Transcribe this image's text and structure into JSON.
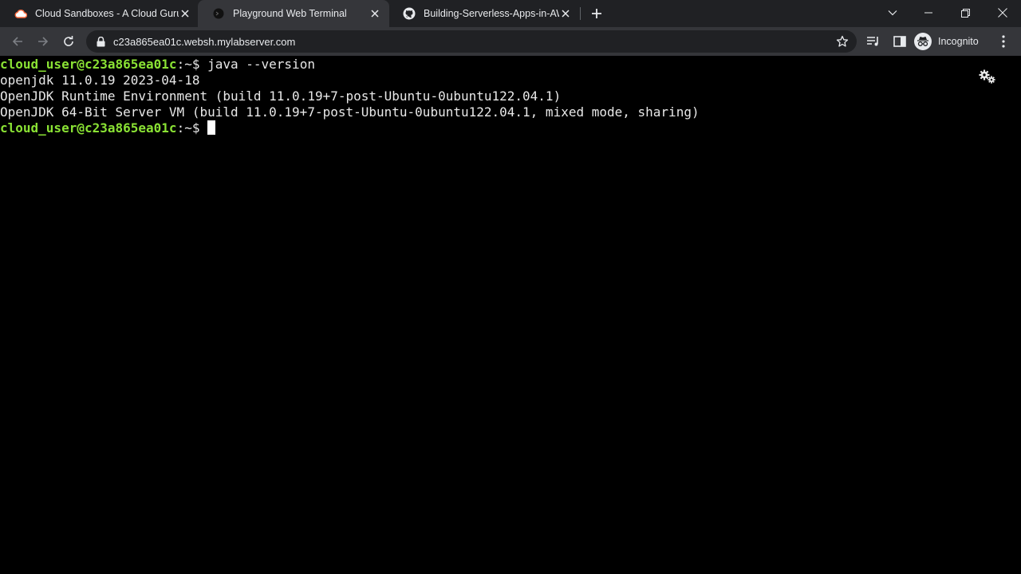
{
  "browser": {
    "tabs": [
      {
        "title": "Cloud Sandboxes - A Cloud Guru",
        "favicon": "cloud-guru-icon",
        "active": false
      },
      {
        "title": "Playground Web Terminal",
        "favicon": "terminal-icon",
        "active": true
      },
      {
        "title": "Building-Serverless-Apps-in-AWS",
        "favicon": "github-icon",
        "active": false
      }
    ],
    "url": "c23a865ea01c.websh.mylabserver.com",
    "profile_label": "Incognito"
  },
  "terminal": {
    "lines": [
      {
        "prompt": "cloud_user@c23a865ea01c",
        "path": ":~$ ",
        "text": "java --version"
      },
      {
        "text": "openjdk 11.0.19 2023-04-18"
      },
      {
        "text": "OpenJDK Runtime Environment (build 11.0.19+7-post-Ubuntu-0ubuntu122.04.1)"
      },
      {
        "text": "OpenJDK 64-Bit Server VM (build 11.0.19+7-post-Ubuntu-0ubuntu122.04.1, mixed mode, sharing)"
      },
      {
        "prompt": "cloud_user@c23a865ea01c",
        "path": ":~$ ",
        "text": ""
      }
    ]
  },
  "colors": {
    "prompt": "#8ae234",
    "terminal_bg": "#000000",
    "tabstrip_bg": "#202124",
    "toolbar_bg": "#35363a",
    "acg_orange": "#ff6a3d"
  }
}
